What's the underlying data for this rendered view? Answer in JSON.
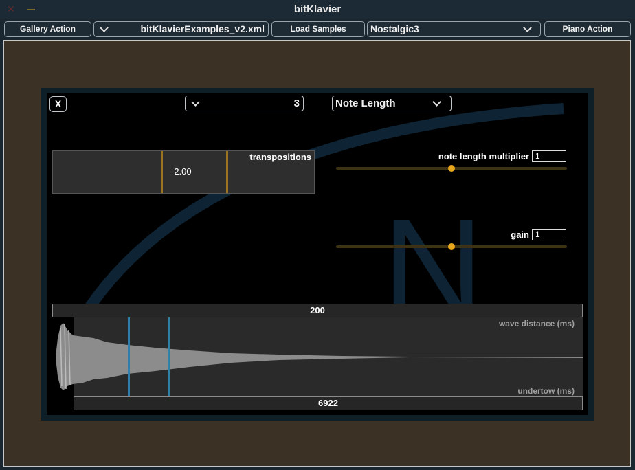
{
  "window": {
    "title": "bitKlavier"
  },
  "toolbar": {
    "gallery_action": "Gallery Action",
    "gallery_file": "bitKlavierExamples_v2.xml",
    "load_samples": "Load Samples",
    "piano": "Nostalgic3",
    "piano_action": "Piano Action"
  },
  "panel": {
    "close_label": "X",
    "preparation_selector": "3",
    "mode_selector": "Note Length",
    "transpositions": {
      "label": "transpositions",
      "value": "-2.00"
    },
    "note_length_multiplier": {
      "label": "note length multiplier",
      "value": "1",
      "fraction": 0.5
    },
    "gain": {
      "label": "gain",
      "value": "1",
      "fraction": 0.5
    },
    "wave_distance": {
      "value": "200",
      "label": "wave distance (ms)"
    },
    "undertow": {
      "value": "6922",
      "label": "undertow (ms)"
    },
    "logo_letter": "N"
  },
  "colors": {
    "accent": "#e8a61a",
    "playhead": "#2f7fa8",
    "logo": "#10263a"
  }
}
